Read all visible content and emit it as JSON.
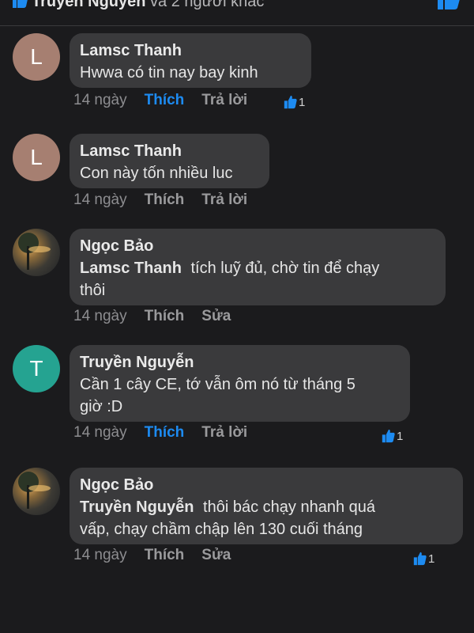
{
  "header": {
    "author": "Truyền Nguyễn",
    "rest": "và 2 người khác"
  },
  "comments": [
    {
      "avatar_letter": "L",
      "author": "Lamsc Thanh",
      "mention": "",
      "lines": [
        "Hwwa có tin nay bay kinh"
      ],
      "time": "14 ngày",
      "like": "Thích",
      "second_action": "Trả lời",
      "reaction_count": "1"
    },
    {
      "avatar_letter": "L",
      "author": "Lamsc Thanh",
      "mention": "",
      "lines": [
        "Con này tốn nhiều luc"
      ],
      "time": "14 ngày",
      "like": "Thích",
      "second_action": "Trả lời",
      "reaction_count": ""
    },
    {
      "avatar_letter": "",
      "author": "Ngọc Bảo",
      "mention": "Lamsc Thanh",
      "lines": [
        "tích luỹ đủ, chờ tin để chạy",
        "thôi"
      ],
      "time": "14 ngày",
      "like": "Thích",
      "second_action": "Sửa",
      "reaction_count": ""
    },
    {
      "avatar_letter": "T",
      "author": "Truyền Nguyễn",
      "mention": "",
      "lines": [
        "Cần 1 cây CE, tớ vẫn ôm nó từ tháng 5",
        "giờ :D"
      ],
      "time": "14 ngày",
      "like": "Thích",
      "second_action": "Trả lời",
      "reaction_count": "1"
    },
    {
      "avatar_letter": "",
      "author": "Ngọc Bảo",
      "mention": "Truyền Nguyễn",
      "lines": [
        "thôi bác chạy nhanh quá",
        "vấp, chạy chầm chập lên 130 cuối tháng"
      ],
      "time": "14 ngày",
      "like": "Thích",
      "second_action": "Sửa",
      "reaction_count": "1"
    }
  ],
  "colors": {
    "accent": "#1d8bf1",
    "bubble": "#3a3a3c",
    "background": "#1b1b1d"
  }
}
